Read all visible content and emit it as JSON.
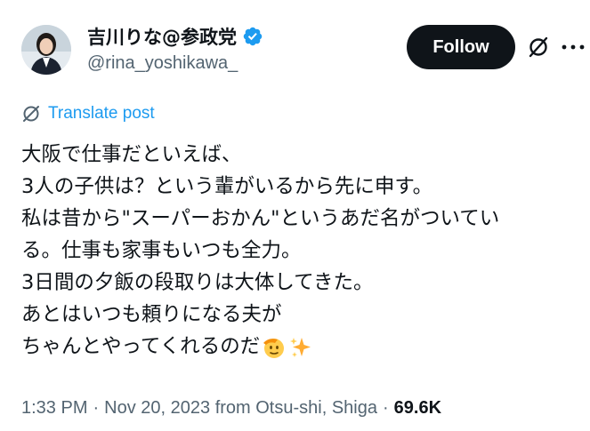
{
  "author": {
    "display_name": "吉川りな@参政党",
    "handle": "@rina_yoshikawa_",
    "verified": true
  },
  "actions": {
    "follow_label": "Follow"
  },
  "translate": {
    "label": "Translate post"
  },
  "post": {
    "lines": [
      "大阪で仕事だといえば、",
      "3人の子供は？という輩がいるから先に申す。",
      "私は昔から\"スーパーおかん\"というあだ名がついてい",
      "る。仕事も家事もいつも全力。",
      "3日間の夕飯の段取りは大体してきた。",
      "あとはいつも頼りになる夫が",
      "ちゃんとやってくれるのだ"
    ],
    "emojis": [
      "saluting-face",
      "sparkles"
    ]
  },
  "meta": {
    "time": "1:33 PM",
    "separator": "·",
    "date": "Nov 20, 2023 from Otsu-shi, Shiga",
    "views_count": "69.6K",
    "views_label": ""
  },
  "colors": {
    "accent": "#1d9bf0",
    "text": "#0f1419",
    "muted": "#536471",
    "button": "#0f1419"
  }
}
